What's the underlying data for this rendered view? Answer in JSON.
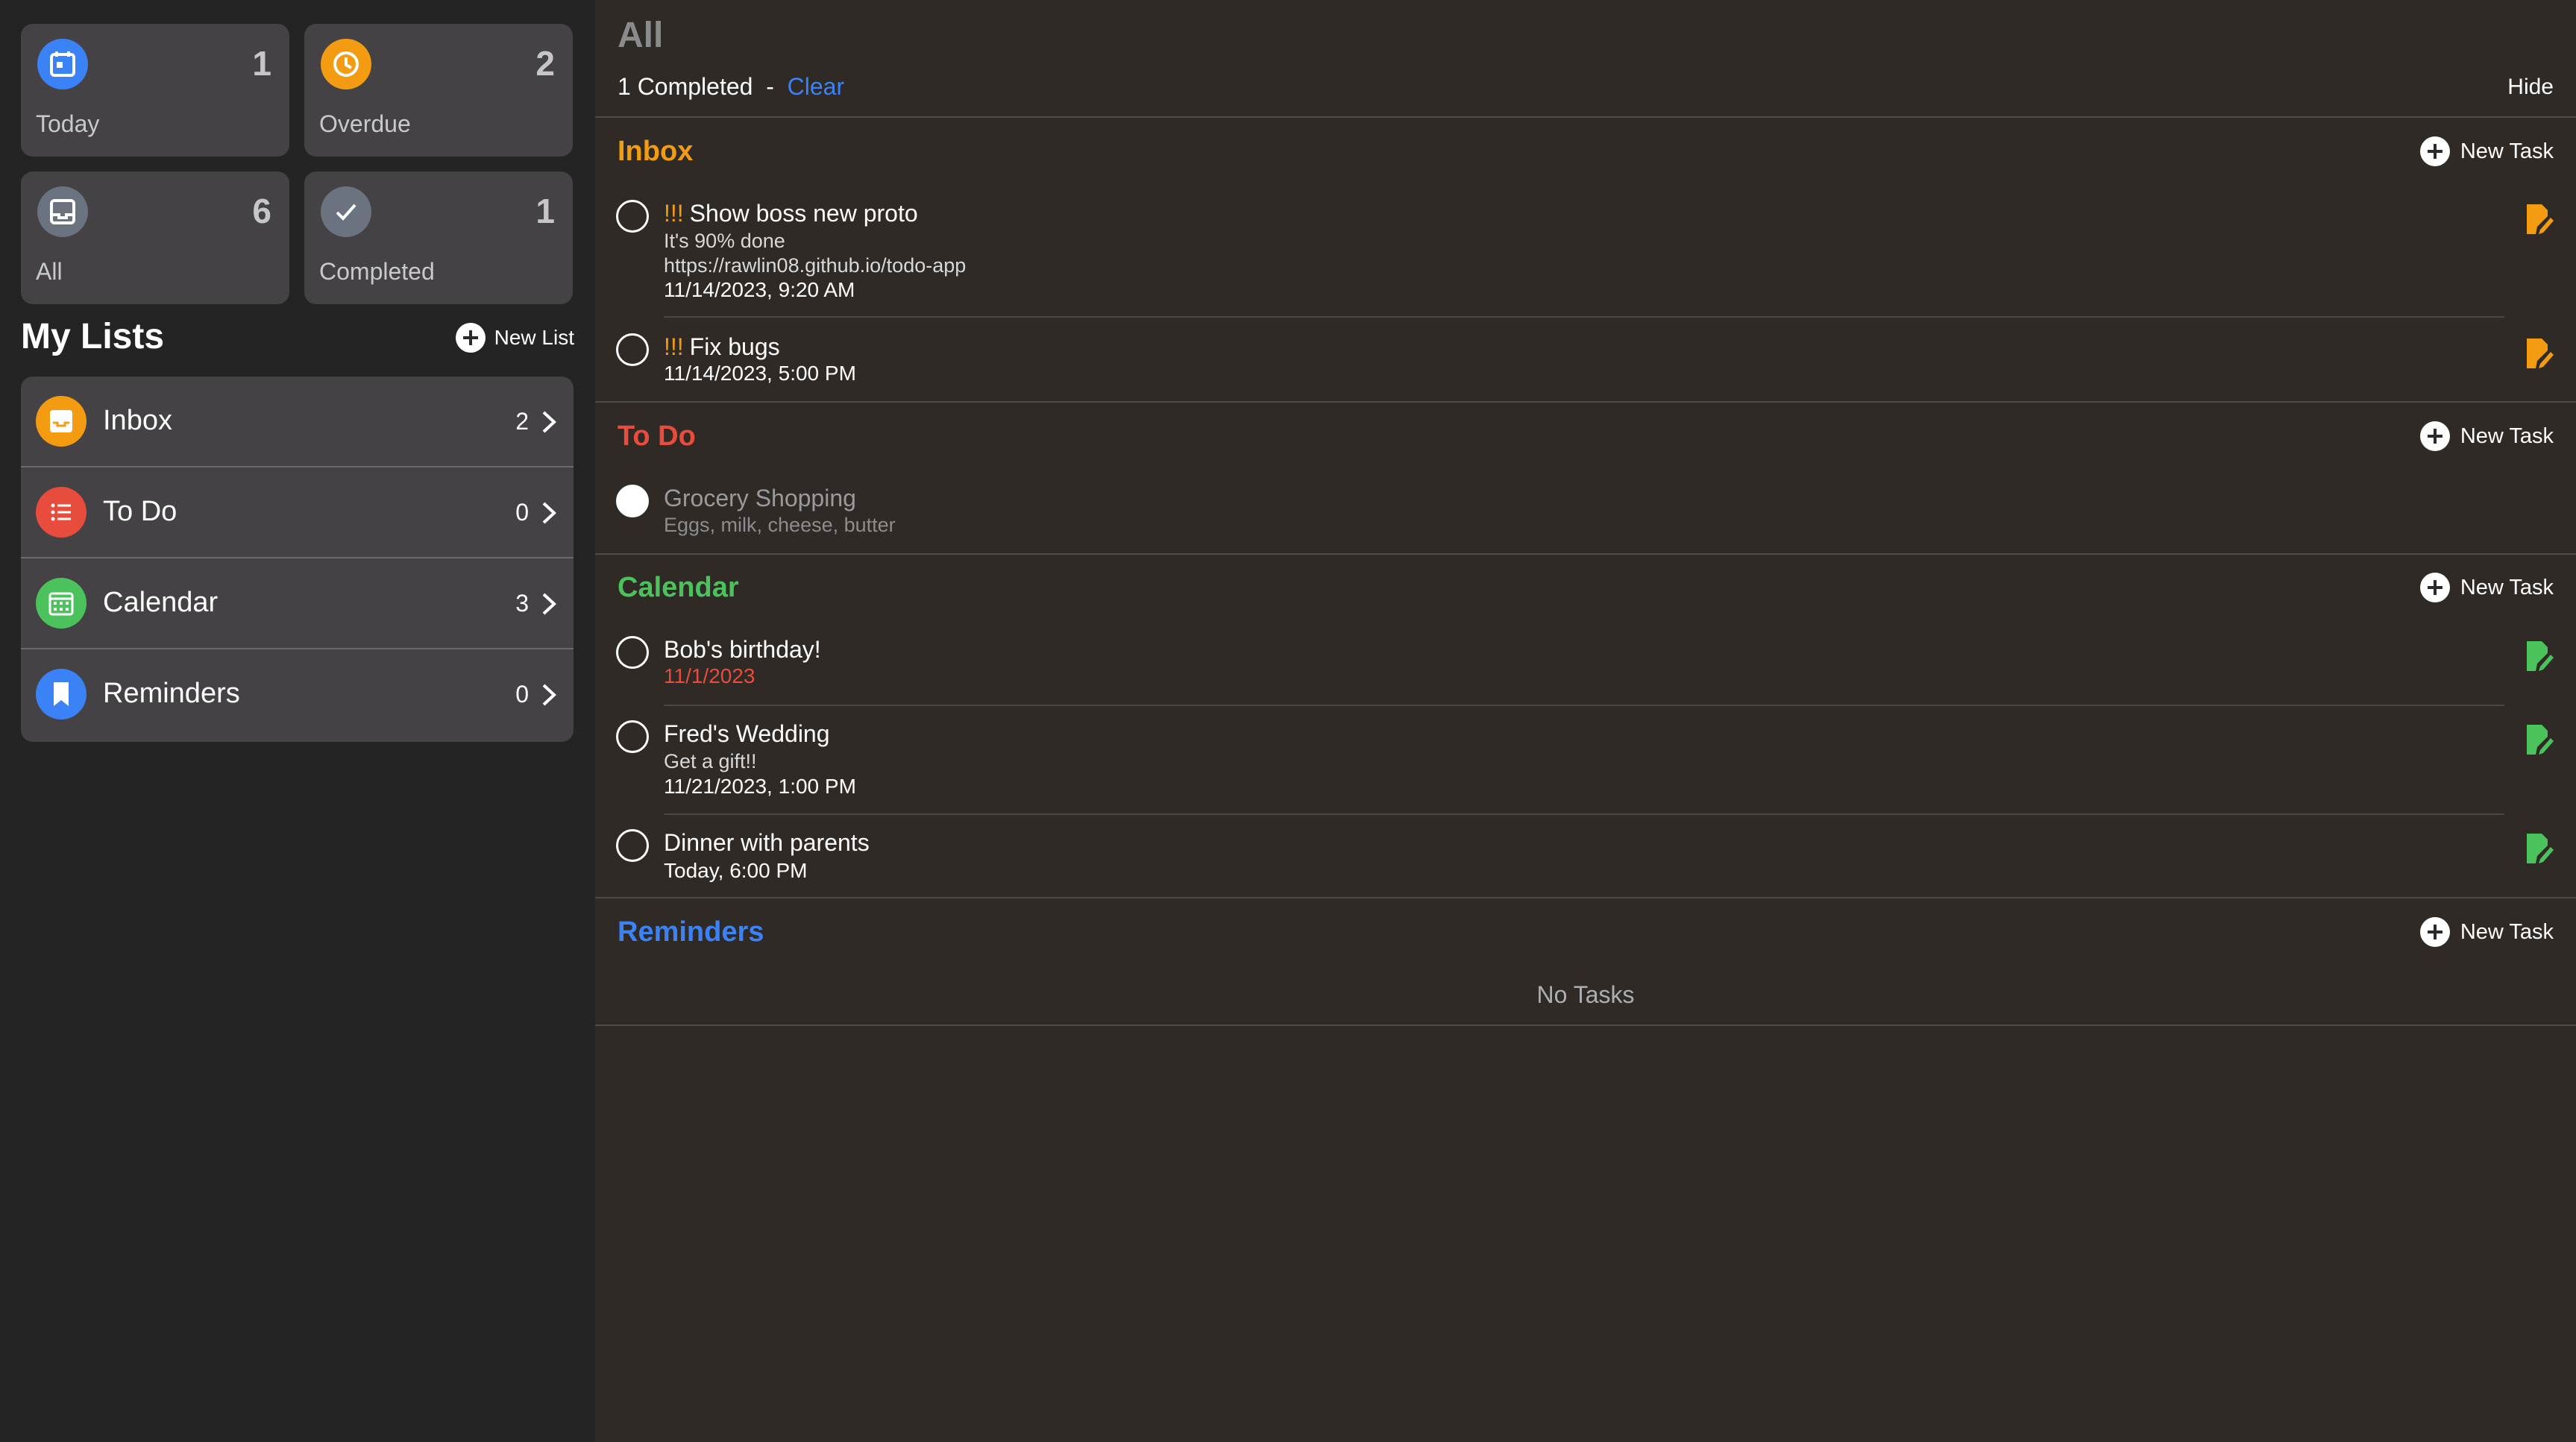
{
  "summary_tiles": {
    "today": {
      "label": "Today",
      "count": "1",
      "color": "#3b82f6"
    },
    "overdue": {
      "label": "Overdue",
      "count": "2",
      "color": "#f39c12"
    },
    "all": {
      "label": "All",
      "count": "6",
      "color": "#6b7280"
    },
    "completed": {
      "label": "Completed",
      "count": "1",
      "color": "#6b7280"
    }
  },
  "my_lists": {
    "title": "My Lists",
    "new_list_label": "New List",
    "items": [
      {
        "name": "Inbox",
        "count": "2",
        "color": "#f39c12",
        "icon": "inbox-icon"
      },
      {
        "name": "To Do",
        "count": "0",
        "color": "#e74c3c",
        "icon": "list-icon"
      },
      {
        "name": "Calendar",
        "count": "3",
        "color": "#4cc25c",
        "icon": "calendar-icon"
      },
      {
        "name": "Reminders",
        "count": "0",
        "color": "#3b82f6",
        "icon": "bookmark-icon"
      }
    ]
  },
  "main": {
    "title": "All",
    "completed_text": "1 Completed",
    "separator": "-",
    "clear_label": "Clear",
    "hide_label": "Hide",
    "new_task_label": "New Task",
    "no_tasks_text": "No Tasks",
    "sections": {
      "inbox": {
        "title": "Inbox",
        "color": "#f39c12",
        "tasks": [
          {
            "priority": "!!!",
            "title": "Show boss new proto",
            "notes": "It's 90% done",
            "url": "https://rawlin08.github.io/todo-app",
            "date": "11/14/2023, 9:20 AM"
          },
          {
            "priority": "!!!",
            "title": "Fix bugs",
            "date": "11/14/2023, 5:00 PM"
          }
        ]
      },
      "todo": {
        "title": "To Do",
        "color": "#e74c3c",
        "tasks": [
          {
            "title": "Grocery Shopping",
            "notes": "Eggs, milk, cheese, butter",
            "completed": true
          }
        ]
      },
      "calendar": {
        "title": "Calendar",
        "color": "#4cc25c",
        "tasks": [
          {
            "title": "Bob's birthday!",
            "date": "11/1/2023",
            "overdue": true
          },
          {
            "title": "Fred's Wedding",
            "notes": "Get a gift!!",
            "date": "11/21/2023, 1:00 PM"
          },
          {
            "title": "Dinner with parents",
            "date": "Today, 6:00 PM"
          }
        ]
      },
      "reminders": {
        "title": "Reminders",
        "color": "#3b82f6",
        "tasks": []
      }
    }
  }
}
